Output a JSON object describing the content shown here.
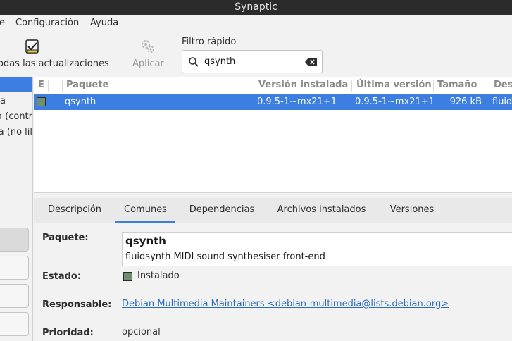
{
  "window": {
    "title": "Synaptic"
  },
  "menu": {
    "items": [
      "e",
      "Configuración",
      "Ayuda"
    ]
  },
  "toolbar": {
    "mark_all_label": "odas las actualizaciones",
    "apply_label": "Aplicar",
    "filter_label": "Filtro rápido",
    "filter_value": "qsynth"
  },
  "sidebar": {
    "items": [
      "a",
      "a (contr",
      "a (no lil"
    ]
  },
  "package_list": {
    "columns": [
      "E",
      "Paquete",
      "Versión instalada",
      "Última versión",
      "Tamaño",
      "Des"
    ],
    "rows": [
      {
        "status": "installed",
        "name": "qsynth",
        "installed_version": "0.9.5-1~mx21+1",
        "latest_version": "0.9.5-1~mx21+1",
        "size": "926 kB",
        "description": "fluidsy"
      }
    ]
  },
  "tabs": [
    "Descripción",
    "Comunes",
    "Dependencias",
    "Archivos instalados",
    "Versiones"
  ],
  "details": {
    "package_label": "Paquete:",
    "package_name": "qsynth",
    "package_summary": "fluidsynth MIDI sound synthesiser front-end",
    "state_label": "Estado:",
    "state_value": "Instalado",
    "maintainer_label": "Responsable:",
    "maintainer_value": "Debian Multimedia Maintainers <debian-multimedia@lists.debian.org>",
    "priority_label": "Prioridad:",
    "priority_value": "opcional"
  },
  "colors": {
    "selection": "#3d7ee1",
    "installed": "#6d8f6d",
    "titlebar": "#2b2b2b",
    "link": "#2a6cc0"
  }
}
